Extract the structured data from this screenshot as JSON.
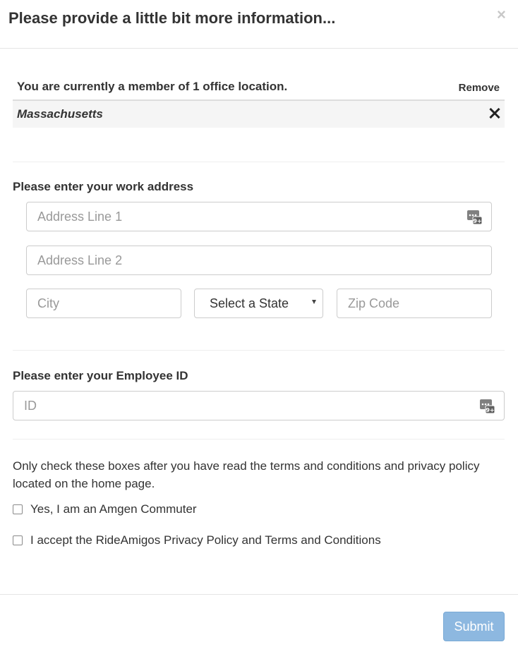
{
  "modal": {
    "title": "Please provide a little bit more information...",
    "close_glyph": "×"
  },
  "membership": {
    "text": "You are currently a member of 1 office location.",
    "remove_label": "Remove",
    "locations": [
      {
        "name": "Massachusetts"
      }
    ]
  },
  "work_address": {
    "label": "Please enter your work address",
    "address_line_1": {
      "value": "",
      "placeholder": "Address Line 1"
    },
    "address_line_2": {
      "value": "",
      "placeholder": "Address Line 2"
    },
    "city": {
      "value": "",
      "placeholder": "City"
    },
    "state": {
      "selected": "Select a State"
    },
    "zip": {
      "value": "",
      "placeholder": "Zip Code"
    }
  },
  "employee": {
    "label": "Please enter your Employee ID",
    "id": {
      "value": "",
      "placeholder": "ID"
    }
  },
  "agreements": {
    "note": "Only check these boxes after you have read the terms and conditions and privacy policy located on the home page.",
    "commuter": {
      "label": "Yes, I am an Amgen Commuter",
      "checked": false
    },
    "privacy": {
      "label": "I accept the RideAmigos Privacy Policy and Terms and Conditions",
      "checked": false
    }
  },
  "footer": {
    "submit_label": "Submit"
  },
  "icons": {
    "autofill": "password-manager-autofill-icon",
    "remove": "close-x-icon"
  },
  "colors": {
    "submit_bg": "#8db8e0",
    "text": "#333333",
    "placeholder": "#999999",
    "border": "#cccccc"
  }
}
